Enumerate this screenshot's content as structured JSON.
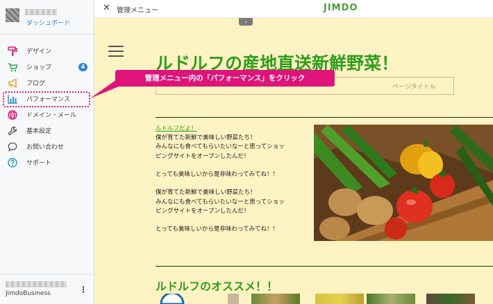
{
  "sidebar": {
    "dashboard_link": "ダッシュボード",
    "items": [
      {
        "label": "デザイン",
        "icon": "paint-roller-icon"
      },
      {
        "label": "ショップ",
        "icon": "cart-icon",
        "badge": "4"
      },
      {
        "label": "ブログ",
        "icon": "megaphone-icon"
      },
      {
        "label": "パフォーマンス",
        "icon": "bar-chart-icon"
      },
      {
        "label": "ドメイン・メール",
        "icon": "globe-icon"
      },
      {
        "label": "基本設定",
        "icon": "wrench-icon"
      },
      {
        "label": "お問い合わせ",
        "icon": "chat-icon"
      },
      {
        "label": "サポート",
        "icon": "help-icon"
      }
    ],
    "plan": "JimdoBusiness",
    "more_icon": "⋮"
  },
  "topbar": {
    "title": "管理メニュー",
    "logo": "JIMDO",
    "close": "✕",
    "collapse": "⌄"
  },
  "site": {
    "title": "ルドルフの産地直送新鮮野菜！",
    "subtitle_placeholder": "ページタイトル",
    "link": "ルドルフだよ！",
    "paragraphs": [
      "僕が育てた新鮮で美味しい野菜たち！",
      "みんなにも食べてもらいたいなーと思ってショッ",
      "ピングサイトをオープンしたんだ！",
      "",
      "とっても美味しいから是非味わってみてね！！",
      "",
      "僕が育てた新鮮で美味しい野菜たち！",
      "みんなにも食べてもらいたいなーと思ってショッ",
      "ピングサイトをオープンしたんだ！",
      "",
      "とっても美味しいから是非味わってみてね！！"
    ],
    "recommend_title": "ルドルフのオススメ！！"
  },
  "callout": {
    "text": "管理メニュー内の「パフォーマンス」をクリック"
  },
  "colors": {
    "accent": "#2e88d6",
    "highlight": "#e0137a",
    "site_green": "#2f9e1a",
    "site_bg": "#fdf3c3"
  }
}
